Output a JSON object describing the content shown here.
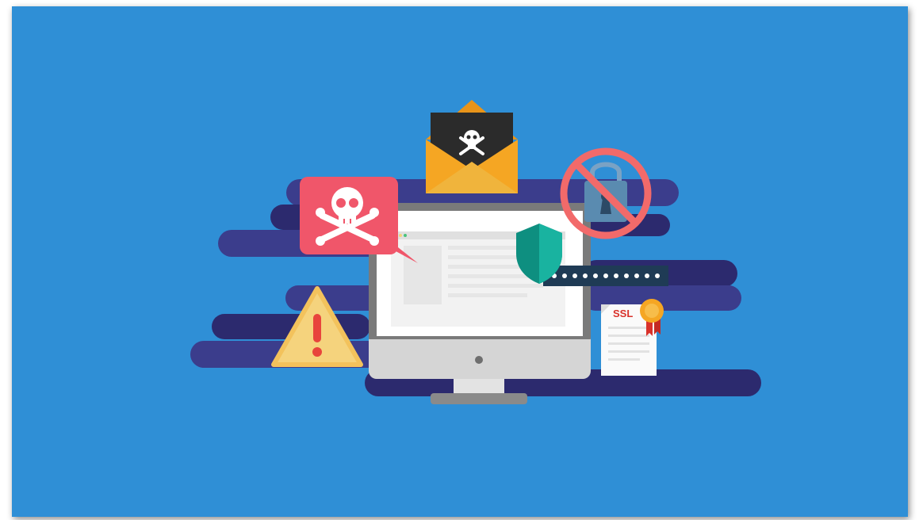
{
  "certificate": {
    "label": "SSL"
  },
  "colors": {
    "background": "#2f8fd6",
    "streaks_dark": "#2c2a6e",
    "streaks_mid": "#3b3d8c",
    "monitor_frame": "#d5d5d5",
    "monitor_bezel": "#7a7a7a",
    "alert_bubble": "#f0566a",
    "warning_triangle": "#f5d37d",
    "warning_mark": "#e8443c",
    "envelope": "#f5a623",
    "letter": "#2b2b2b",
    "shield": "#19b3a0",
    "password_bar": "#1f3b55",
    "ban_circle": "#f26a6a",
    "padlock": "#5a8bb0",
    "ssl_text": "#d9322b",
    "seal": "#f5a623"
  },
  "icons": [
    "skull-crossbones-icon",
    "warning-triangle-icon",
    "envelope-icon",
    "shield-icon",
    "padlock-icon",
    "no-entry-icon",
    "certificate-icon",
    "award-seal-icon"
  ]
}
